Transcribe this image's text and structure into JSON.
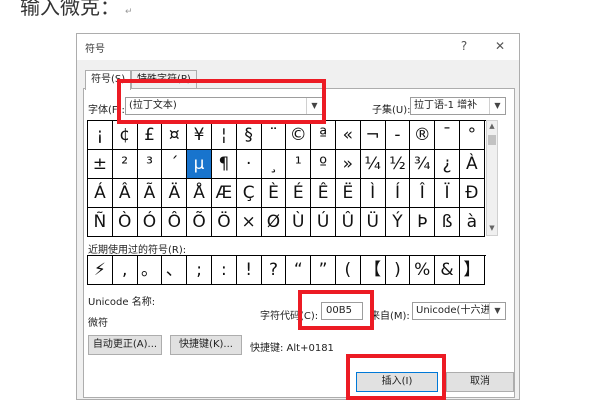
{
  "doc": {
    "heading": "输入微克：",
    "para_mark": "↵"
  },
  "dialog": {
    "title": "符号",
    "help": "?",
    "close": "✕",
    "tabs": [
      "符号(S)",
      "特殊字符(P)"
    ],
    "font_label": "字体(F):",
    "font_value": "(拉丁文本)",
    "subset_label": "子集(U):",
    "subset_value": "拉丁语-1 增补",
    "symbols": [
      [
        "¡",
        "¢",
        "£",
        "¤",
        "¥",
        "¦",
        "§",
        "¨",
        "©",
        "ª",
        "«",
        "¬",
        "-",
        "®",
        "¯",
        "°"
      ],
      [
        "±",
        "²",
        "³",
        "´",
        "µ",
        "¶",
        "·",
        "¸",
        "¹",
        "º",
        "»",
        "¼",
        "½",
        "¾",
        "¿",
        "À"
      ],
      [
        "Á",
        "Â",
        "Ã",
        "Ä",
        "Å",
        "Æ",
        "Ç",
        "È",
        "É",
        "Ê",
        "Ë",
        "Ì",
        "Í",
        "Î",
        "Ï",
        "Ð"
      ],
      [
        "Ñ",
        "Ò",
        "Ó",
        "Ô",
        "Õ",
        "Ö",
        "×",
        "Ø",
        "Ù",
        "Ú",
        "Û",
        "Ü",
        "Ý",
        "Þ",
        "ß",
        "à"
      ]
    ],
    "selected_symbol": "µ",
    "recent_label": "近期使用过的符号(R):",
    "recent": [
      "⚡",
      ",",
      "。",
      "、",
      ";",
      ":",
      "!",
      "?",
      "“",
      "”",
      "(",
      "【",
      ")",
      "%",
      "&",
      "】"
    ],
    "unicode_name_label": "Unicode 名称:",
    "unicode_name_value": "微符",
    "char_code_label": "字符代码(C):",
    "char_code_value": "00B5",
    "from_label": "来自(M):",
    "from_value": "Unicode(十六进制)",
    "autocorrect_button": "自动更正(A)...",
    "shortcut_key_button": "快捷键(K)...",
    "shortcut_text": "快捷键: Alt+0181",
    "insert_button": "插入(I)",
    "cancel_button": "取消"
  },
  "colors": {
    "selection": "#1874cd",
    "highlight_box": "#ec1b24",
    "default_button_border": "#0078d7"
  }
}
